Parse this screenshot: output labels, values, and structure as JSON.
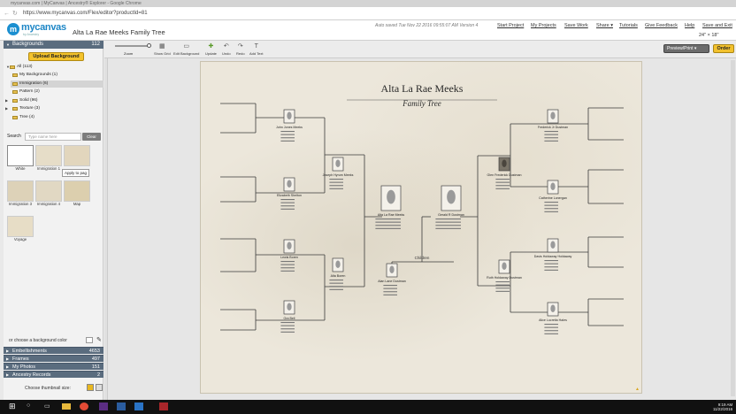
{
  "browser": {
    "title_text": "mycanvas.com | MyCanvas | Ancestry® Explorer - Google Chrome",
    "url": "https://www.mycanvas.com/Flex/editor?productId=81"
  },
  "app": {
    "logo_text": "mycanvas",
    "logo_sub": "by Ancestry",
    "project_title": "Alta La Rae Meeks Family Tree",
    "autosave": "Auto saved Tue Nov 22 2016 09:55:07 AM Version 4",
    "links": [
      "Start Project",
      "My Projects",
      "Save Work",
      "Share ▾",
      "Tutorials",
      "Give Feedback",
      "Help",
      "Save and Exit"
    ],
    "page_size": "24\" × 18\""
  },
  "sidebar": {
    "header": "Backgrounds",
    "header_count": "112",
    "upload_label": "Upload Background",
    "tree": {
      "root": "All (113)",
      "items": [
        "My Backgrounds (1)",
        "Immigration (6)",
        "Pattern (2)",
        "Solid (96)",
        "Texture (3)",
        "Tree (4)"
      ],
      "selected_index": 1
    },
    "search_label": "Search",
    "search_placeholder": "Type name here",
    "clear_label": "Clear",
    "thumbnails": [
      {
        "label": "White",
        "color": "#ffffff"
      },
      {
        "label": "Immigration 1",
        "color": "#e6ddc8"
      },
      {
        "label": "",
        "color": "#e2d6bd"
      },
      {
        "label": "Immigration 3",
        "color": "#ddd2b8"
      },
      {
        "label": "Immigration 4",
        "color": "#e1d8c3"
      },
      {
        "label": "Map",
        "color": "#dccfae"
      },
      {
        "label": "Voyage",
        "color": "#e7ddc6"
      }
    ],
    "apply_tooltip": "Apply to pag",
    "bgcolor_label": "or choose a background color",
    "accordion": [
      {
        "label": "Embellishments",
        "count": "4653"
      },
      {
        "label": "Frames",
        "count": "497"
      },
      {
        "label": "My Photos",
        "count": "151"
      },
      {
        "label": "Ancestry Records",
        "count": "2"
      }
    ],
    "thumb_size_label": "Choose thumbnail size:"
  },
  "toolbar": {
    "zoom_label": "Zoom",
    "zoom_value": 0.85,
    "tools": [
      "Show Grid",
      "Edit Background",
      "Update",
      "Undo",
      "Redo",
      "Add Text"
    ],
    "preview_label": "Preview/Print ▾",
    "order_label": "Order"
  },
  "tree": {
    "title": "Alta La Rae Meeks",
    "subtitle": "Family Tree",
    "children_label": "Children",
    "root": "Alta La Rae Meeks",
    "spouse": "Gerald R Dustman",
    "child": "Alan Lane Dustman",
    "parents": [
      "Joseph Hyrum Meeks",
      "Alta Boren",
      "Glen Frederick Dustman",
      "Ruth Holdaway Dustman"
    ],
    "grandparents": [
      "John Jones Meeks",
      "Elizabeth Shelton",
      "Lewis Boren",
      "Ora Bell",
      "Frederick Jr Dustman",
      "Catherine Lonergan",
      "Davis Holdaway Holdaway",
      "Alice Lucretia Hales"
    ]
  },
  "taskbar": {
    "time": "9:19 AM",
    "date": "11/22/2016"
  }
}
